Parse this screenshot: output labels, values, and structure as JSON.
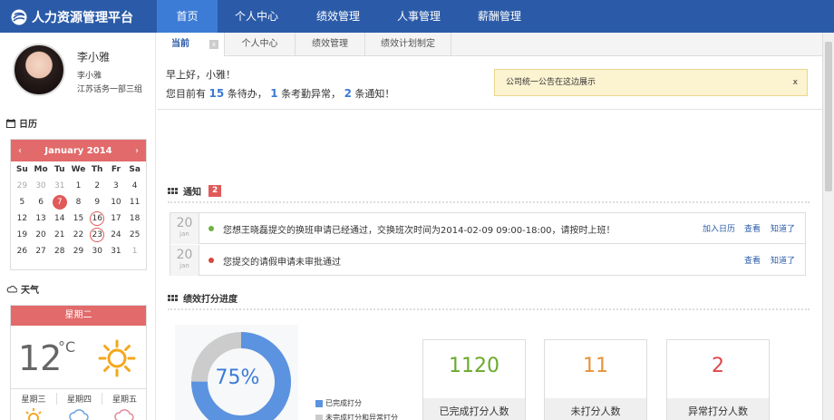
{
  "app": {
    "title": "人力资源管理平台"
  },
  "nav": [
    {
      "label": "首页"
    },
    {
      "label": "个人中心"
    },
    {
      "label": "绩效管理"
    },
    {
      "label": "人事管理"
    },
    {
      "label": "薪酬管理"
    }
  ],
  "user": {
    "name": "李小雅",
    "line1": "李小雅",
    "line2": "江苏话务一部三组"
  },
  "calendar": {
    "section": "日历",
    "month": "January 2014",
    "prev": "‹",
    "next": "›",
    "weekdays": [
      "Su",
      "Mo",
      "Tu",
      "We",
      "Th",
      "Fr",
      "Sa"
    ],
    "weeks": [
      [
        "29",
        "30",
        "31",
        "1",
        "2",
        "3",
        "4"
      ],
      [
        "5",
        "6",
        "7",
        "8",
        "9",
        "10",
        "11"
      ],
      [
        "12",
        "13",
        "14",
        "15",
        "16",
        "17",
        "18"
      ],
      [
        "19",
        "20",
        "21",
        "22",
        "23",
        "24",
        "25"
      ],
      [
        "26",
        "27",
        "28",
        "29",
        "30",
        "31",
        "1"
      ]
    ],
    "today": "7",
    "marked": [
      "16",
      "23"
    ]
  },
  "weather": {
    "section": "天气",
    "day": "星期二",
    "temp": "12",
    "unit": "°C",
    "forecast": [
      "星期三",
      "星期四",
      "星期五"
    ]
  },
  "tabs": [
    {
      "label": "当前"
    },
    {
      "label": "个人中心"
    },
    {
      "label": "绩效管理"
    },
    {
      "label": "绩效计划制定"
    }
  ],
  "greeting": {
    "line1": "早上好，小雅！",
    "pre": "您目前有",
    "pending": "15",
    "pending_label": "条待办，",
    "abnormal": "1",
    "abnormal_label": "条考勤异常，",
    "notices": "2",
    "notices_label": "条通知！"
  },
  "announcement": {
    "text": "公司统一公告在这边展示",
    "close": "x"
  },
  "tiles": [
    {
      "icon": "clipboard-icon",
      "color": "#f2b58f"
    },
    {
      "icon": "settings-clipboard-icon",
      "color": "#ee9a7a"
    },
    {
      "icon": "edit-icon",
      "color": "#a9cbf3"
    },
    {
      "icon": "award-icon",
      "color": "#f6cb8b"
    }
  ],
  "notifications": {
    "title": "通知",
    "count": "2",
    "items": [
      {
        "day": "20",
        "month": "jan",
        "color": "#6db33f",
        "text": "您想王晓磊提交的换班申请已经通过，交换班次时间为2014-02-09 09:00-18:00，请按时上班！",
        "actions": [
          "加入日历",
          "查看",
          "知道了"
        ]
      },
      {
        "day": "20",
        "month": "jan",
        "color": "#d9463a",
        "text": "您提交的请假申请未审批通过",
        "actions": [
          "查看",
          "知道了"
        ]
      }
    ]
  },
  "progress": {
    "title": "绩效打分进度",
    "percent": "75%",
    "percent_value": 0.75,
    "legend": [
      {
        "label": "已完成打分",
        "color": "#5b93e0"
      },
      {
        "label": "未完成打分和异常打分",
        "color": "#cccccc"
      }
    ],
    "stats": [
      {
        "value": "1120",
        "label": "已完成打分人数",
        "color": "#6aaa2a"
      },
      {
        "value": "11",
        "label": "未打分人数",
        "color": "#e8913a"
      },
      {
        "value": "2",
        "label": "异常打分人数",
        "color": "#e0474c"
      }
    ]
  }
}
